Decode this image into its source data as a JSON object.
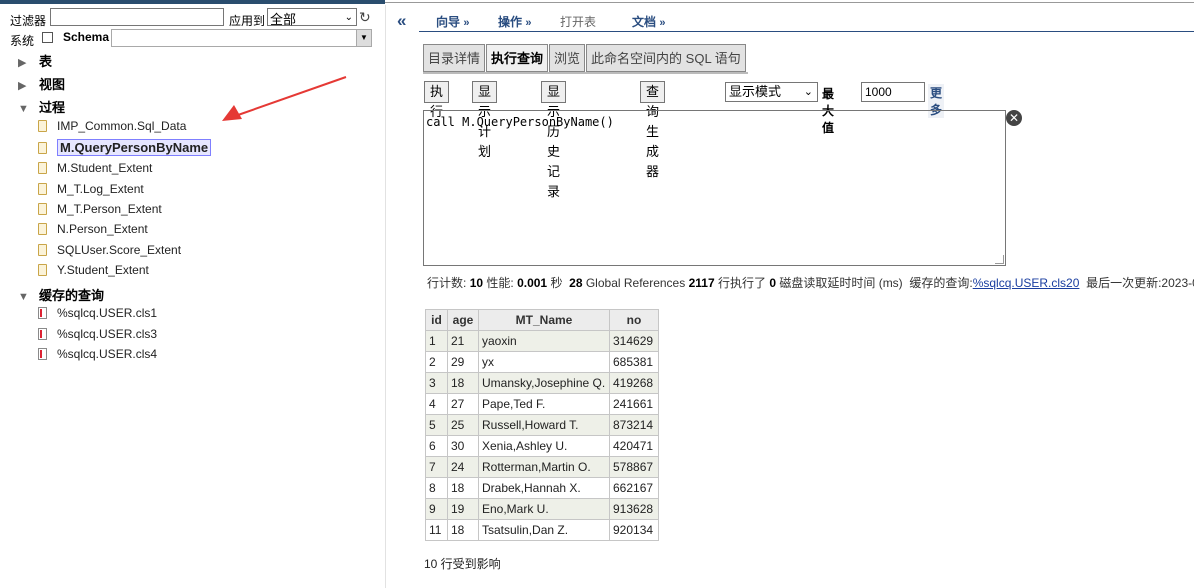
{
  "left": {
    "filter_label": "过滤器",
    "filter_value": "",
    "apply_label": "应用到",
    "apply_value": "全部",
    "system_label": "系统",
    "schema_label": "Schema",
    "schema_value": "",
    "tree": [
      {
        "label": "表",
        "expanded": false
      },
      {
        "label": "视图",
        "expanded": false
      },
      {
        "label": "过程",
        "expanded": true
      },
      {
        "label": "缓存的查询",
        "expanded": true
      }
    ],
    "procedures": [
      "IMP_Common.Sql_Data",
      "M.QueryPersonByName",
      "M.Student_Extent",
      "M_T.Log_Extent",
      "M_T.Person_Extent",
      "N.Person_Extent",
      "SQLUser.Score_Extent",
      "Y.Student_Extent"
    ],
    "selected_procedure": "M.QueryPersonByName",
    "cached_queries": [
      "%sqlcq.USER.cls1",
      "%sqlcq.USER.cls3",
      "%sqlcq.USER.cls4"
    ]
  },
  "menu": {
    "collapse_glyph": "«",
    "items": [
      {
        "label": "向导",
        "chev": "»"
      },
      {
        "label": "操作",
        "chev": "»"
      },
      {
        "label": "打开表",
        "chev": ""
      },
      {
        "label": "文档",
        "chev": "»"
      }
    ]
  },
  "tabs": [
    "目录详情",
    "执行查询",
    "浏览",
    "此命名空间内的 SQL 语句"
  ],
  "active_tab": "执行查询",
  "toolbar": {
    "execute": "执行",
    "show_plan": "显示计划",
    "show_history": "显示历史记录",
    "query_builder": "查询生成器",
    "display_mode": "显示模式",
    "max_label": "最大值",
    "max_value": "1000",
    "more": "更多"
  },
  "sql_text": "call M.QueryPersonByName()",
  "stats": {
    "row_count_label": "行计数:",
    "row_count": "10",
    "perf_label": "性能:",
    "perf": "0.001",
    "perf_unit": "秒",
    "global_refs": "28",
    "global_refs_label": "Global References",
    "lines_executed": "2117",
    "lines_executed_label": "行执行了",
    "disk_read": "0",
    "disk_read_label": "磁盘读取延时时间 (ms)",
    "cached_query_label": "缓存的查询:",
    "cached_query_link": "%sqlcq.USER.cls20",
    "last_update_label": "最后一次更新:2023-0"
  },
  "results": {
    "columns": [
      "id",
      "age",
      "MT_Name",
      "no"
    ],
    "rows": [
      [
        "1",
        "21",
        "yaoxin",
        "314629"
      ],
      [
        "2",
        "29",
        "yx",
        "685381"
      ],
      [
        "3",
        "18",
        "Umansky,Josephine Q.",
        "419268"
      ],
      [
        "4",
        "27",
        "Pape,Ted F.",
        "241661"
      ],
      [
        "5",
        "25",
        "Russell,Howard T.",
        "873214"
      ],
      [
        "6",
        "30",
        "Xenia,Ashley U.",
        "420471"
      ],
      [
        "7",
        "24",
        "Rotterman,Martin O.",
        "578867"
      ],
      [
        "8",
        "18",
        "Drabek,Hannah X.",
        "662167"
      ],
      [
        "9",
        "19",
        "Eno,Mark U.",
        "913628"
      ],
      [
        "11",
        "18",
        "Tsatsulin,Dan Z.",
        "920134"
      ]
    ]
  },
  "affected_text": "10 行受到影响",
  "colors": {
    "accent": "#2a4d80",
    "annotation_arrow": "#e53935"
  }
}
